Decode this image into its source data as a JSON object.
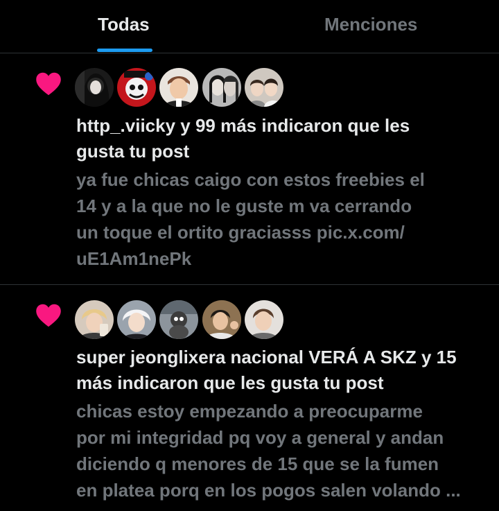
{
  "tabs": [
    {
      "label": "Todas",
      "active": true
    },
    {
      "label": "Menciones",
      "active": false
    }
  ],
  "colors": {
    "background": "#000000",
    "text_primary": "#e7e9ea",
    "text_secondary": "#71767b",
    "accent": "#1d9bf0",
    "like": "#f91880",
    "divider": "#2f3336"
  },
  "notifications": [
    {
      "type": "like",
      "icon": "heart-icon",
      "avatar_count": 5,
      "headline_line1": "http_.viicky y 99 más indicaron que les",
      "headline_line2": "gusta tu post",
      "body_lines": [
        "ya fue chicas caigo con estos freebies el",
        "14 y a la que no le guste m va cerrando",
        "un toque el ortito graciasss pic.x.com/",
        "uE1Am1nePk"
      ]
    },
    {
      "type": "like",
      "icon": "heart-icon",
      "avatar_count": 5,
      "headline_line1": "super jeonglixera nacional VERÁ A SKZ y 15",
      "headline_line2": "más indicaron que les gusta tu post",
      "body_lines": [
        "chicas estoy empezando a preocuparme",
        "por mi integridad pq voy a general y andan",
        "diciendo q menores de 15 que se la fumen",
        "en platea porq en los pogos salen volando ..."
      ]
    }
  ]
}
